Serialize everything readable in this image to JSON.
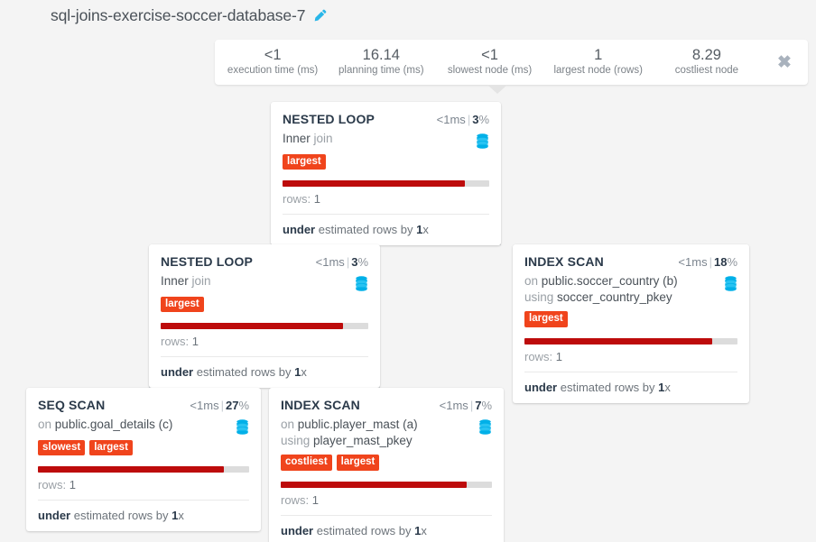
{
  "header": {
    "title": "sql-joins-exercise-soccer-database-7",
    "edit_icon": "pencil-icon"
  },
  "stats": {
    "close_label": "✖",
    "items": [
      {
        "value": "<1",
        "label": "execution time (ms)"
      },
      {
        "value": "16.14",
        "label": "planning time (ms)"
      },
      {
        "value": "<1",
        "label": "slowest node (ms)"
      },
      {
        "value": "1",
        "label": "largest node (rows)"
      },
      {
        "value": "8.29",
        "label": "costliest node"
      }
    ]
  },
  "colors": {
    "badge": "#f0441c",
    "bar_fill": "#bd0b0b",
    "bar_track": "#dcdcdc",
    "db_icon": "#00b0e8",
    "page_bg": "#f4f4f4"
  },
  "nodes": [
    {
      "id": "nested-loop-root",
      "title": "NESTED LOOP",
      "time": "<1ms",
      "separator": "|",
      "percent": "3",
      "percent_sign": "%",
      "sub_line1_prefix": "Inner",
      "sub_line1_value": "join",
      "sub_line2_prefix": "",
      "sub_line2_value": "",
      "badges": [
        "largest"
      ],
      "bar_percent": 88,
      "rows_label": "rows:",
      "rows_value": "1",
      "estimate_strong": "under",
      "estimate_mid": "estimated rows by",
      "estimate_factor": "1",
      "estimate_suffix": "x"
    },
    {
      "id": "nested-loop-child",
      "title": "NESTED LOOP",
      "time": "<1ms",
      "separator": "|",
      "percent": "3",
      "percent_sign": "%",
      "sub_line1_prefix": "Inner",
      "sub_line1_value": "join",
      "sub_line2_prefix": "",
      "sub_line2_value": "",
      "badges": [
        "largest"
      ],
      "bar_percent": 88,
      "rows_label": "rows:",
      "rows_value": "1",
      "estimate_strong": "under",
      "estimate_mid": "estimated rows by",
      "estimate_factor": "1",
      "estimate_suffix": "x"
    },
    {
      "id": "index-scan-soccer-country",
      "title": "INDEX SCAN",
      "time": "<1ms",
      "separator": "|",
      "percent": "18",
      "percent_sign": "%",
      "sub_line1_prefix": "on",
      "sub_line1_value": "public.soccer_country (b)",
      "sub_line2_prefix": "using",
      "sub_line2_value": "soccer_country_pkey",
      "badges": [
        "largest"
      ],
      "bar_percent": 88,
      "rows_label": "rows:",
      "rows_value": "1",
      "estimate_strong": "under",
      "estimate_mid": "estimated rows by",
      "estimate_factor": "1",
      "estimate_suffix": "x"
    },
    {
      "id": "seq-scan-goal-details",
      "title": "SEQ SCAN",
      "time": "<1ms",
      "separator": "|",
      "percent": "27",
      "percent_sign": "%",
      "sub_line1_prefix": "on",
      "sub_line1_value": "public.goal_details (c)",
      "sub_line2_prefix": "",
      "sub_line2_value": "",
      "badges": [
        "slowest",
        "largest"
      ],
      "bar_percent": 88,
      "rows_label": "rows:",
      "rows_value": "1",
      "estimate_strong": "under",
      "estimate_mid": "estimated rows by",
      "estimate_factor": "1",
      "estimate_suffix": "x"
    },
    {
      "id": "index-scan-player-mast",
      "title": "INDEX SCAN",
      "time": "<1ms",
      "separator": "|",
      "percent": "7",
      "percent_sign": "%",
      "sub_line1_prefix": "on",
      "sub_line1_value": "public.player_mast (a)",
      "sub_line2_prefix": "using",
      "sub_line2_value": "player_mast_pkey",
      "badges": [
        "costliest",
        "largest"
      ],
      "bar_percent": 88,
      "rows_label": "rows:",
      "rows_value": "1",
      "estimate_strong": "under",
      "estimate_mid": "estimated rows by",
      "estimate_factor": "1",
      "estimate_suffix": "x"
    }
  ]
}
